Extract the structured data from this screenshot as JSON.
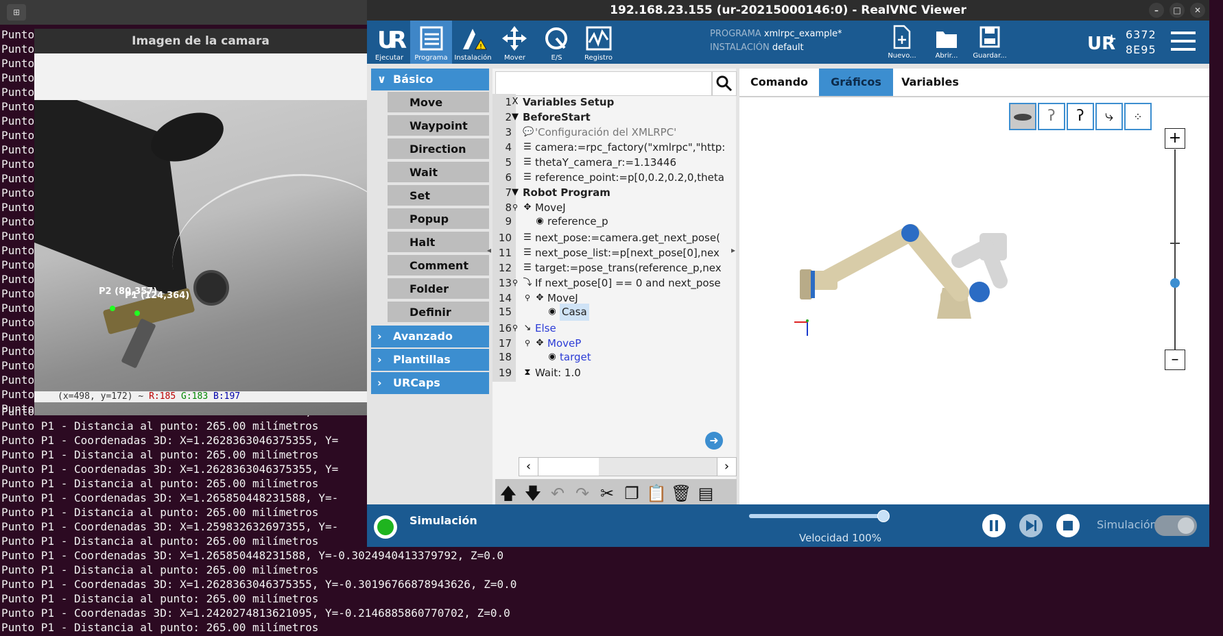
{
  "terminal": {
    "lines_top": [
      "Punto",
      "Punto",
      "Punto",
      "Punto",
      "Punto",
      "Punto",
      "Punto",
      "Punto",
      "Punto",
      "Punto",
      "Punto",
      "Punto",
      "Punto",
      "Punto",
      "Punto",
      "Punto",
      "Punto",
      "Punto",
      "Punto",
      "Punto",
      "Punto",
      "Punto",
      "Punto",
      "Punto",
      "Punto",
      "Punto",
      "Punto"
    ],
    "lines_bottom": [
      "Punto P1 - Coordenadas 3D: X=1.265850448231588, Y=-",
      "Punto P1 - Distancia al punto: 265.00 milímetros",
      "Punto P1 - Coordenadas 3D: X=1.2628363046375355, Y=",
      "Punto P1 - Distancia al punto: 265.00 milímetros",
      "Punto P1 - Coordenadas 3D: X=1.2628363046375355, Y=",
      "Punto P1 - Distancia al punto: 265.00 milímetros",
      "Punto P1 - Coordenadas 3D: X=1.265850448231588, Y=-",
      "Punto P1 - Distancia al punto: 265.00 milímetros",
      "Punto P1 - Coordenadas 3D: X=1.259832632697355, Y=-",
      "Punto P1 - Distancia al punto: 265.00 milímetros",
      "Punto P1 - Coordenadas 3D: X=1.265850448231588, Y=-0.3024940413379792, Z=0.0",
      "Punto P1 - Distancia al punto: 265.00 milímetros",
      "Punto P1 - Coordenadas 3D: X=1.2628363046375355, Y=-0.30196766878943626, Z=0.0",
      "Punto P1 - Distancia al punto: 265.00 milímetros",
      "Punto P1 - Coordenadas 3D: X=1.2420274813621095, Y=-0.2146885860770702, Z=0.0",
      "Punto P1 - Distancia al punto: 265.00 milímetros"
    ]
  },
  "camera": {
    "title": "Imagen de la camara",
    "label_p2": "P2 (80,357)",
    "label_p1": "P1 (124,364)",
    "status_prefix": "(x=498, y=172) ~ ",
    "status_r": "R:185",
    "status_g": "G:183",
    "status_b": "B:197"
  },
  "vnc": {
    "title": "192.168.23.155 (ur-20215000146:0) - RealVNC Viewer"
  },
  "header": {
    "buttons": [
      {
        "label": "Ejecutar"
      },
      {
        "label": "Programa"
      },
      {
        "label": "Instalación"
      },
      {
        "label": "Mover"
      },
      {
        "label": "E/S"
      },
      {
        "label": "Registro"
      }
    ],
    "programa_label": "PROGRAMA",
    "programa_value": "xmlrpc_example*",
    "instalacion_label": "INSTALACIÓN",
    "instalacion_value": "default",
    "new_label": "Nuevo...",
    "open_label": "Abrir...",
    "save_label": "Guardar...",
    "serial_1": "6372",
    "serial_2": "8E95"
  },
  "left": {
    "basico": "Básico",
    "commands": [
      "Move",
      "Waypoint",
      "Direction",
      "Wait",
      "Set",
      "Popup",
      "Halt",
      "Comment",
      "Folder",
      "Definir carga"
    ],
    "avanzado": "Avanzado",
    "plantillas": "Plantillas",
    "urcaps": "URCaps"
  },
  "tree": {
    "lines": [
      {
        "n": "1",
        "text": "Variables Setup"
      },
      {
        "n": "2",
        "text": "BeforeStart"
      },
      {
        "n": "3",
        "text": "'Configuración del XMLRPC'"
      },
      {
        "n": "4",
        "text": "camera:=rpc_factory(\"xmlrpc\",\"http:"
      },
      {
        "n": "5",
        "text": "thetaY_camera_r:=1.13446"
      },
      {
        "n": "6",
        "text": "reference_point:=p[0,0.2,0.2,0,theta"
      },
      {
        "n": "7",
        "text": "Robot Program"
      },
      {
        "n": "8",
        "text": "MoveJ"
      },
      {
        "n": "9",
        "text": "reference_p"
      },
      {
        "n": "10",
        "text": "next_pose:=camera.get_next_pose("
      },
      {
        "n": "11",
        "text": "next_pose_list:=p[next_pose[0],nex"
      },
      {
        "n": "12",
        "text": "target:=pose_trans(reference_p,nex"
      },
      {
        "n": "13",
        "text": "If next_pose[0] == 0 and next_pose"
      },
      {
        "n": "14",
        "text": "MoveJ"
      },
      {
        "n": "15",
        "text": "Casa"
      },
      {
        "n": "16",
        "text": "Else"
      },
      {
        "n": "17",
        "text": "MoveP"
      },
      {
        "n": "18",
        "text": "target"
      },
      {
        "n": "19",
        "text": "Wait: 1.0"
      }
    ]
  },
  "right": {
    "tabs": [
      "Comando",
      "Gráficos",
      "Variables"
    ]
  },
  "footer": {
    "sim_label": "Simulación",
    "speed_label": "Velocidad 100%",
    "speed_fraction": 1.0,
    "sim_right": "Simulación"
  },
  "colors": {
    "ur_blue": "#1b5a91",
    "ur_accent": "#3c8ed0",
    "terminal_bg": "#2c0a22"
  }
}
